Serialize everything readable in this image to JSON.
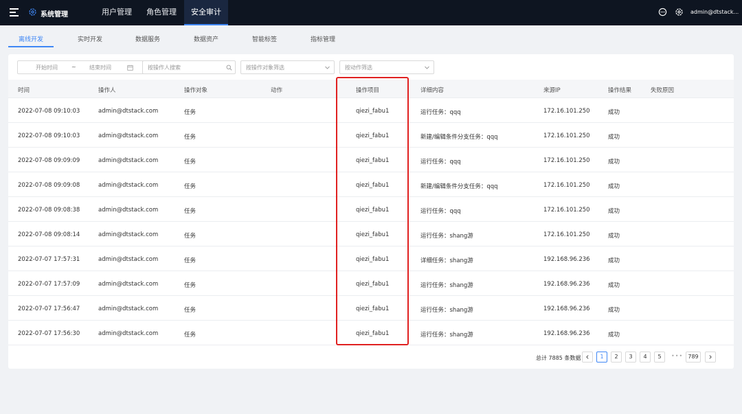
{
  "topbar": {
    "brand": "系统管理",
    "nav": [
      "用户管理",
      "角色管理",
      "安全审计"
    ],
    "user": "admin@dtstack...",
    "accent": "#3f87f5"
  },
  "subtabs": [
    "离线开发",
    "实时开发",
    "数据服务",
    "数据资产",
    "智能标签",
    "指标管理"
  ],
  "filters": {
    "start_time": "开始时间",
    "range_sep": "~",
    "end_time": "结束时间",
    "operator_search": "按操作人搜索",
    "object_filter": "按操作对象筛选",
    "action_filter": "按动作筛选"
  },
  "table": {
    "columns": [
      "时间",
      "操作人",
      "操作对象",
      "动作",
      "操作项目",
      "详细内容",
      "来源IP",
      "操作结果",
      "失败原因"
    ],
    "rows": [
      [
        "2022-07-08 09:10:03",
        "admin@dtstack.com",
        "任务",
        "",
        "qiezi_fabu1",
        "运行任务：qqq",
        "172.16.101.250",
        "成功",
        ""
      ],
      [
        "2022-07-08 09:10:03",
        "admin@dtstack.com",
        "任务",
        "",
        "qiezi_fabu1",
        "新建/编辑条件分支任务：qqq",
        "172.16.101.250",
        "成功",
        ""
      ],
      [
        "2022-07-08 09:09:09",
        "admin@dtstack.com",
        "任务",
        "",
        "qiezi_fabu1",
        "运行任务：qqq",
        "172.16.101.250",
        "成功",
        ""
      ],
      [
        "2022-07-08 09:09:08",
        "admin@dtstack.com",
        "任务",
        "",
        "qiezi_fabu1",
        "新建/编辑条件分支任务：qqq",
        "172.16.101.250",
        "成功",
        ""
      ],
      [
        "2022-07-08 09:08:38",
        "admin@dtstack.com",
        "任务",
        "",
        "qiezi_fabu1",
        "运行任务：qqq",
        "172.16.101.250",
        "成功",
        ""
      ],
      [
        "2022-07-08 09:08:14",
        "admin@dtstack.com",
        "任务",
        "",
        "qiezi_fabu1",
        "运行任务：shang游",
        "172.16.101.250",
        "成功",
        ""
      ],
      [
        "2022-07-07 17:57:31",
        "admin@dtstack.com",
        "任务",
        "",
        "qiezi_fabu1",
        "详细任务：shang游",
        "192.168.96.236",
        "成功",
        ""
      ],
      [
        "2022-07-07 17:57:09",
        "admin@dtstack.com",
        "任务",
        "",
        "qiezi_fabu1",
        "运行任务：shang游",
        "192.168.96.236",
        "成功",
        ""
      ],
      [
        "2022-07-07 17:56:47",
        "admin@dtstack.com",
        "任务",
        "",
        "qiezi_fabu1",
        "运行任务：shang游",
        "192.168.96.236",
        "成功",
        ""
      ],
      [
        "2022-07-07 17:56:30",
        "admin@dtstack.com",
        "任务",
        "",
        "qiezi_fabu1",
        "运行任务：shang游",
        "192.168.96.236",
        "成功",
        ""
      ]
    ]
  },
  "pagination": {
    "total_text": "总计 7885 条数据",
    "pages": [
      "1",
      "2",
      "3",
      "4",
      "5"
    ],
    "ellipsis": "•••",
    "last": "789",
    "current": "1"
  }
}
